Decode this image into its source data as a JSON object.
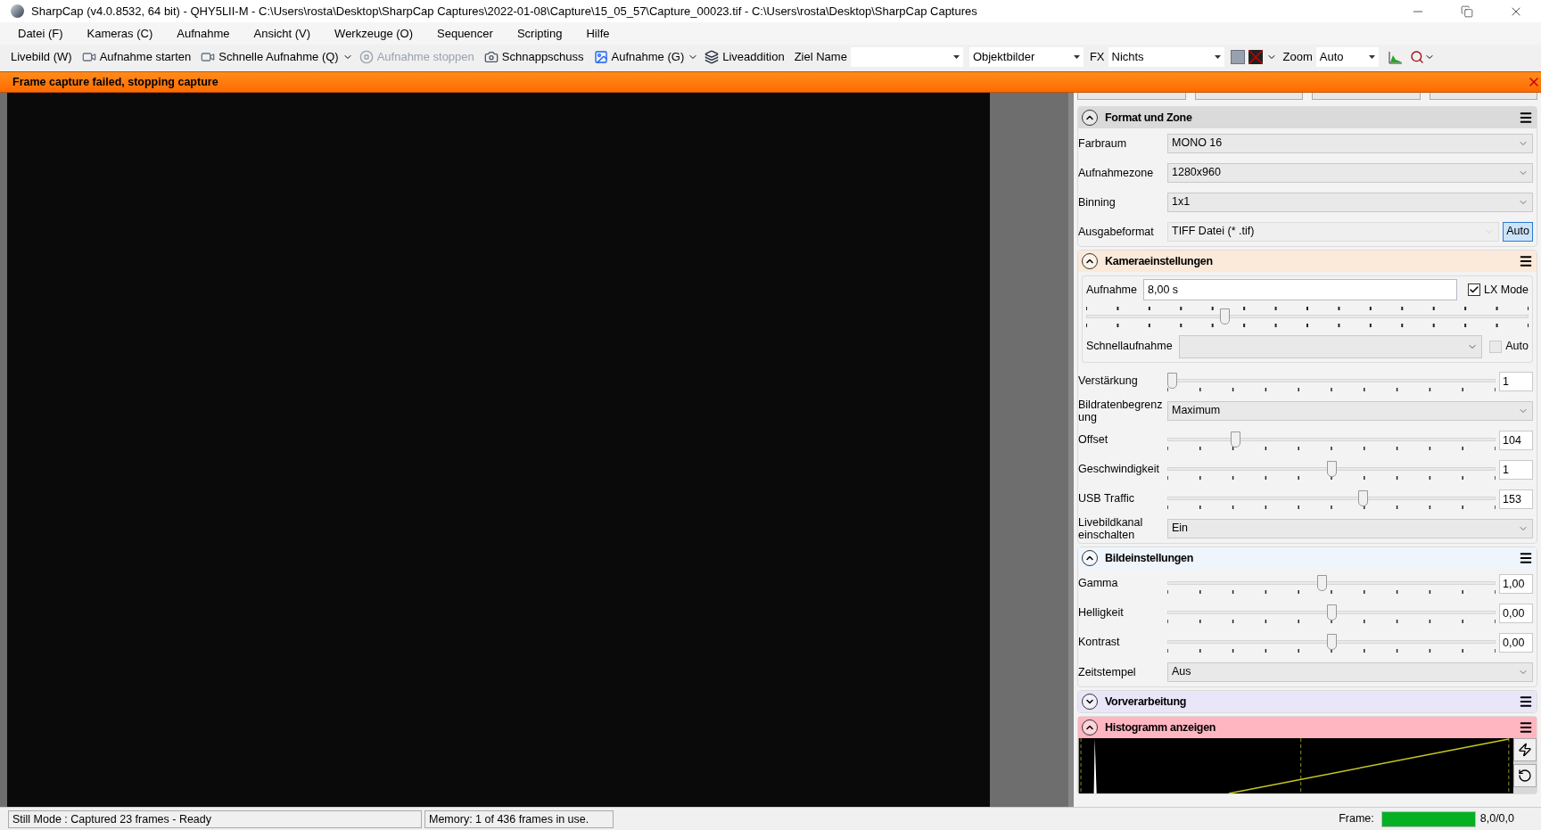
{
  "window": {
    "title": "SharpCap (v4.0.8532, 64 bit) - QHY5LII-M - C:\\Users\\rosta\\Desktop\\SharpCap Captures\\2022-01-08\\Capture\\15_05_57\\Capture_00023.tif - C:\\Users\\rosta\\Desktop\\SharpCap Captures"
  },
  "menu": [
    "Datei (F)",
    "Kameras (C)",
    "Aufnahme",
    "Ansicht (V)",
    "Werkzeuge (O)",
    "Sequencer",
    "Scripting",
    "Hilfe"
  ],
  "toolbar": [
    {
      "kind": "button",
      "label": "Livebild (W)",
      "disabled": false
    },
    {
      "kind": "button",
      "label": "Aufnahme starten",
      "disabled": false
    },
    {
      "kind": "split",
      "label": "Schnelle Aufnahme (Q)",
      "disabled": false
    },
    {
      "kind": "button",
      "label": "Aufnahme stoppen",
      "disabled": true
    },
    {
      "kind": "button",
      "label": "Schnappschuss",
      "disabled": false
    },
    {
      "kind": "split",
      "label": "Aufnahme (G)",
      "disabled": false
    },
    {
      "kind": "button",
      "label": "Liveaddition",
      "disabled": false
    },
    {
      "kind": "combo",
      "label": "Ziel Name"
    },
    {
      "kind": "combo",
      "value": "Objektbilder"
    },
    {
      "kind": "combo",
      "label": "FX",
      "value": "Nichts"
    },
    {
      "kind": "icons"
    },
    {
      "kind": "combo",
      "label": "Zoom",
      "value": "Auto"
    },
    {
      "kind": "tail"
    }
  ],
  "error_bar": {
    "message": "Frame capture failed, stopping capture"
  },
  "panel": {
    "sections": [
      {
        "title": "Format und Zone",
        "expanded": true,
        "color": "#dadada",
        "rows": [
          {
            "kind": "select",
            "label": "Farbraum",
            "value": "MONO 16"
          },
          {
            "kind": "select",
            "label": "Aufnahmezone",
            "value": "1280x960"
          },
          {
            "kind": "select",
            "label": "Binning",
            "value": "1x1"
          },
          {
            "kind": "select_button",
            "label": "Ausgabeformat",
            "value": "TIFF Datei (* .tif)",
            "button": "Auto"
          }
        ]
      },
      {
        "title": "Kameraeinstellungen",
        "expanded": true,
        "color": "#fbe9d9",
        "rows": [
          {
            "kind": "exposure",
            "label": "Aufnahme",
            "value": "8,00 s",
            "checkbox": "LX Mode",
            "checked": true,
            "level": 0.31
          },
          {
            "kind": "quick",
            "label": "Schnellaufnahme",
            "checkbox": "Auto",
            "checked": false
          },
          {
            "kind": "slider",
            "label": "Verstärkung",
            "level": 0.0,
            "value": "1"
          },
          {
            "kind": "select",
            "label": "Bildratenbegrenzung",
            "value": "Maximum"
          },
          {
            "kind": "slider",
            "label": "Offset",
            "level": 0.2,
            "value": "104"
          },
          {
            "kind": "slider",
            "label": "Geschwindigkeit",
            "level": 0.5,
            "value": "1"
          },
          {
            "kind": "slider",
            "label": "USB Traffic",
            "level": 0.6,
            "value": "153"
          },
          {
            "kind": "select",
            "label": "Livebildkanal einschalten",
            "value": "Ein"
          }
        ]
      },
      {
        "title": "Bildeinstellungen",
        "expanded": true,
        "color": "#eef5fd",
        "rows": [
          {
            "kind": "slider",
            "label": "Gamma",
            "level": 0.47,
            "value": "1,00"
          },
          {
            "kind": "slider",
            "label": "Helligkeit",
            "level": 0.5,
            "value": "0,00"
          },
          {
            "kind": "slider",
            "label": "Kontrast",
            "level": 0.5,
            "value": "0,00"
          },
          {
            "kind": "select",
            "label": "Zeitstempel",
            "value": "Aus"
          }
        ]
      },
      {
        "title": "Vorverarbeitung",
        "expanded": false,
        "color": "#e8e6f8"
      },
      {
        "title": "Histogramm anzeigen",
        "expanded": true,
        "color": "#ffb6c1",
        "rows": [
          {
            "kind": "histogram"
          }
        ]
      }
    ]
  },
  "status_bar": {
    "status": "Still Mode : Captured 23 frames - Ready",
    "memory": "Memory: 1 of 436 frames in use.",
    "frame_label": "Frame:",
    "frame_progress": {
      "level": 1.0
    },
    "frame_reading": "8,0/0,0"
  }
}
